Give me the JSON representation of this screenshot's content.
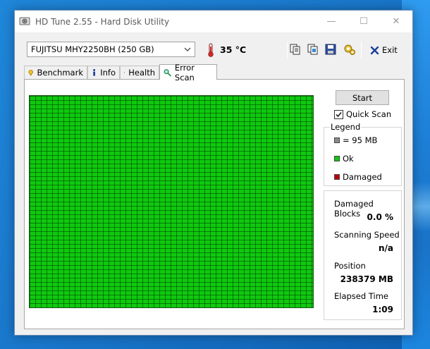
{
  "window": {
    "title": "HD Tune 2.55 - Hard Disk Utility",
    "controls": {
      "minimize": "—",
      "maximize": "☐",
      "close": "✕"
    }
  },
  "toolbar": {
    "drive": "FUJITSU MHY2250BH (250 GB)",
    "temperature": "35 °C",
    "icons": [
      "copy-text-icon",
      "copy-screenshot-icon",
      "save-icon",
      "options-icon"
    ],
    "exit_label": "Exit"
  },
  "tabs": [
    {
      "label": "Benchmark",
      "icon": "benchmark-icon"
    },
    {
      "label": "Info",
      "icon": "info-icon"
    },
    {
      "label": "Health",
      "icon": "health-icon"
    },
    {
      "label": "Error Scan",
      "icon": "magnifier-icon",
      "active": true
    }
  ],
  "scan": {
    "start_label": "Start",
    "quick_scan_label": "Quick Scan",
    "quick_scan_checked": true,
    "block_status": "Ok",
    "colors": {
      "ok": "#0fc90f",
      "damaged": "#c00000",
      "block": "#8c8c8c"
    }
  },
  "legend": {
    "title": "Legend",
    "block_size": "= 95 MB",
    "ok_label": "Ok",
    "damaged_label": "Damaged"
  },
  "stats": {
    "damaged_blocks_label": "Damaged Blocks",
    "damaged_blocks_value": "0.0 %",
    "scanning_speed_label": "Scanning Speed",
    "scanning_speed_value": "n/a",
    "position_label": "Position",
    "position_value": "238379 MB",
    "elapsed_time_label": "Elapsed Time",
    "elapsed_time_value": "1:09"
  }
}
